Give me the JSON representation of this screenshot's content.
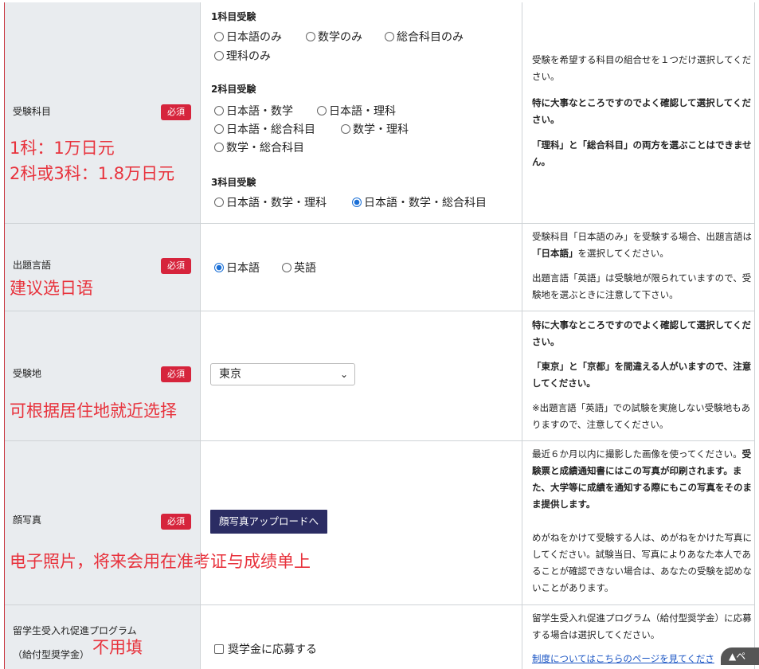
{
  "required_badge": "必須",
  "rows": {
    "subject": {
      "label": "受験科目",
      "annotation_line1": "1科：1万日元",
      "annotation_line2": "2科或3科：1.8万日元",
      "group1": "1科目受験",
      "g1_opt1": "日本語のみ",
      "g1_opt2": "数学のみ",
      "g1_opt3": "総合科目のみ",
      "g1_opt4": "理科のみ",
      "group2": "2科目受験",
      "g2_opt1": "日本語・数学",
      "g2_opt2": "日本語・理科",
      "g2_opt3": "日本語・総合科目",
      "g2_opt4": "数学・理科",
      "g2_opt5": "数学・総合科目",
      "group3": "3科目受験",
      "g3_opt1": "日本語・数学・理科",
      "g3_opt2": "日本語・数学・総合科目",
      "note1": "受験を希望する科目の組合せを１つだけ選択してください。",
      "note2": "特に大事なところですのでよく確認して選択してください。",
      "note3": "「理科」と「総合科目」の両方を選ぶことはできません。"
    },
    "language": {
      "label": "出題言語",
      "annotation": "建议选日语",
      "opt1": "日本語",
      "opt2": "英語",
      "note1_pre": "受験科目「日本語のみ」を受験する場合、出題言語は",
      "note1_bold": "「日本語」",
      "note1_post": "を選択してください。",
      "note2": "出題言語「英語」は受験地が限られていますので、受験地を選ぶときに注意して下さい。"
    },
    "location": {
      "label": "受験地",
      "annotation": "可根据居住地就近选择",
      "selected": "東京",
      "note1": "特に大事なところですのでよく確認して選択してください。",
      "note2": "「東京」と「京都」を間違える人がいますので、注意してください。",
      "note3": "※出題言語「英語」での試験を実施しない受験地もありますので、注意してください。"
    },
    "photo": {
      "label": "顔写真",
      "annotation": "电子照片，将来会用在准考证与成绩单上",
      "button": "顔写真アップロードへ",
      "note1_pre": "最近６か月以内に撮影した画像を使ってください。",
      "note1_bold": "受験票と成績通知書にはこの写真が印刷されます。また、大学等に成績を通知する際にもこの写真をそのまま提供します。",
      "note2": "めがねをかけて受験する人は、めがねをかけた写真にしてください。試験当日、写真によりあなた本人であることが確認できない場合は、あなたの受験を認めないことがあります。"
    },
    "scholarship": {
      "label_line1": "留学生受入れ促進プログラム",
      "label_line2": "（給付型奨学金）",
      "annotation": "不用填",
      "checkbox": "奨学金に応募する",
      "note1": "留学生受入れ促進プログラム（給付型奨学金）に応募する場合は選択してください。",
      "link": "制度についてはこちらのページを見てくださ"
    }
  },
  "page_top": "▲ペ"
}
